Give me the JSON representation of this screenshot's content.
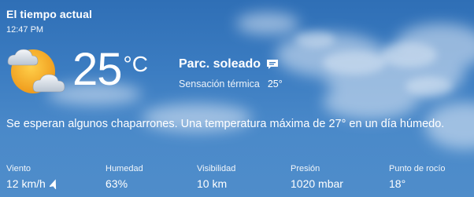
{
  "header": {
    "title": "El tiempo actual",
    "time": "12:47 PM"
  },
  "current": {
    "icon": "partly-sunny-icon",
    "temperature": "25",
    "unit": "°C",
    "condition": "Parc. soleado",
    "feels_like_label": "Sensación térmica",
    "feels_like_value": "25°"
  },
  "summary": "Se esperan algunos chaparrones. Una temperatura máxima de 27° en un día húmedo.",
  "stats": {
    "wind": {
      "label": "Viento",
      "value": "12 km/h"
    },
    "humidity": {
      "label": "Humedad",
      "value": "63%"
    },
    "visibility": {
      "label": "Visibilidad",
      "value": "10 km"
    },
    "pressure": {
      "label": "Presión",
      "value": "1020 mbar"
    },
    "dew_point": {
      "label": "Punto de rocío",
      "value": "18°"
    }
  },
  "colors": {
    "sky_top": "#2f6fb6",
    "sky_bottom": "#4f8dca",
    "sun": "#f0a623"
  }
}
